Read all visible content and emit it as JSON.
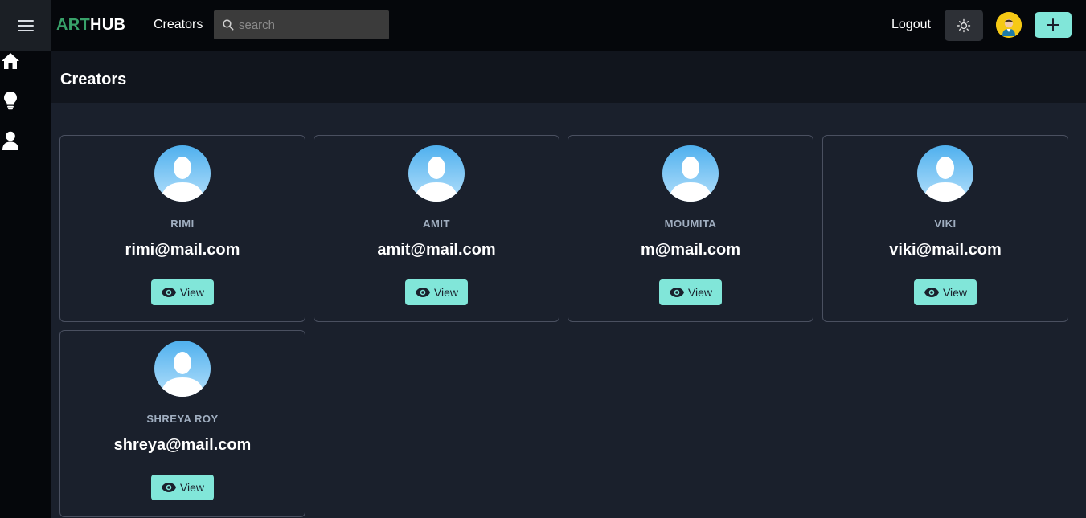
{
  "app": {
    "logo_part1": "ART",
    "logo_part2": "HUB",
    "accent": "#38a169",
    "button_color": "#81e6d9"
  },
  "header": {
    "nav_link": "Creators",
    "search_placeholder": "search",
    "logout": "Logout"
  },
  "sidebar": {
    "items": [
      {
        "icon": "home-icon"
      },
      {
        "icon": "lightbulb-icon"
      },
      {
        "icon": "user-icon"
      }
    ]
  },
  "page": {
    "title": "Creators"
  },
  "creators": [
    {
      "name": "RIMI",
      "email": "rimi@mail.com",
      "button": "View"
    },
    {
      "name": "AMIT",
      "email": "amit@mail.com",
      "button": "View"
    },
    {
      "name": "MOUMITA",
      "email": "m@mail.com",
      "button": "View"
    },
    {
      "name": "VIKI",
      "email": "viki@mail.com",
      "button": "View"
    },
    {
      "name": "SHREYA ROY",
      "email": "shreya@mail.com",
      "button": "View"
    }
  ]
}
